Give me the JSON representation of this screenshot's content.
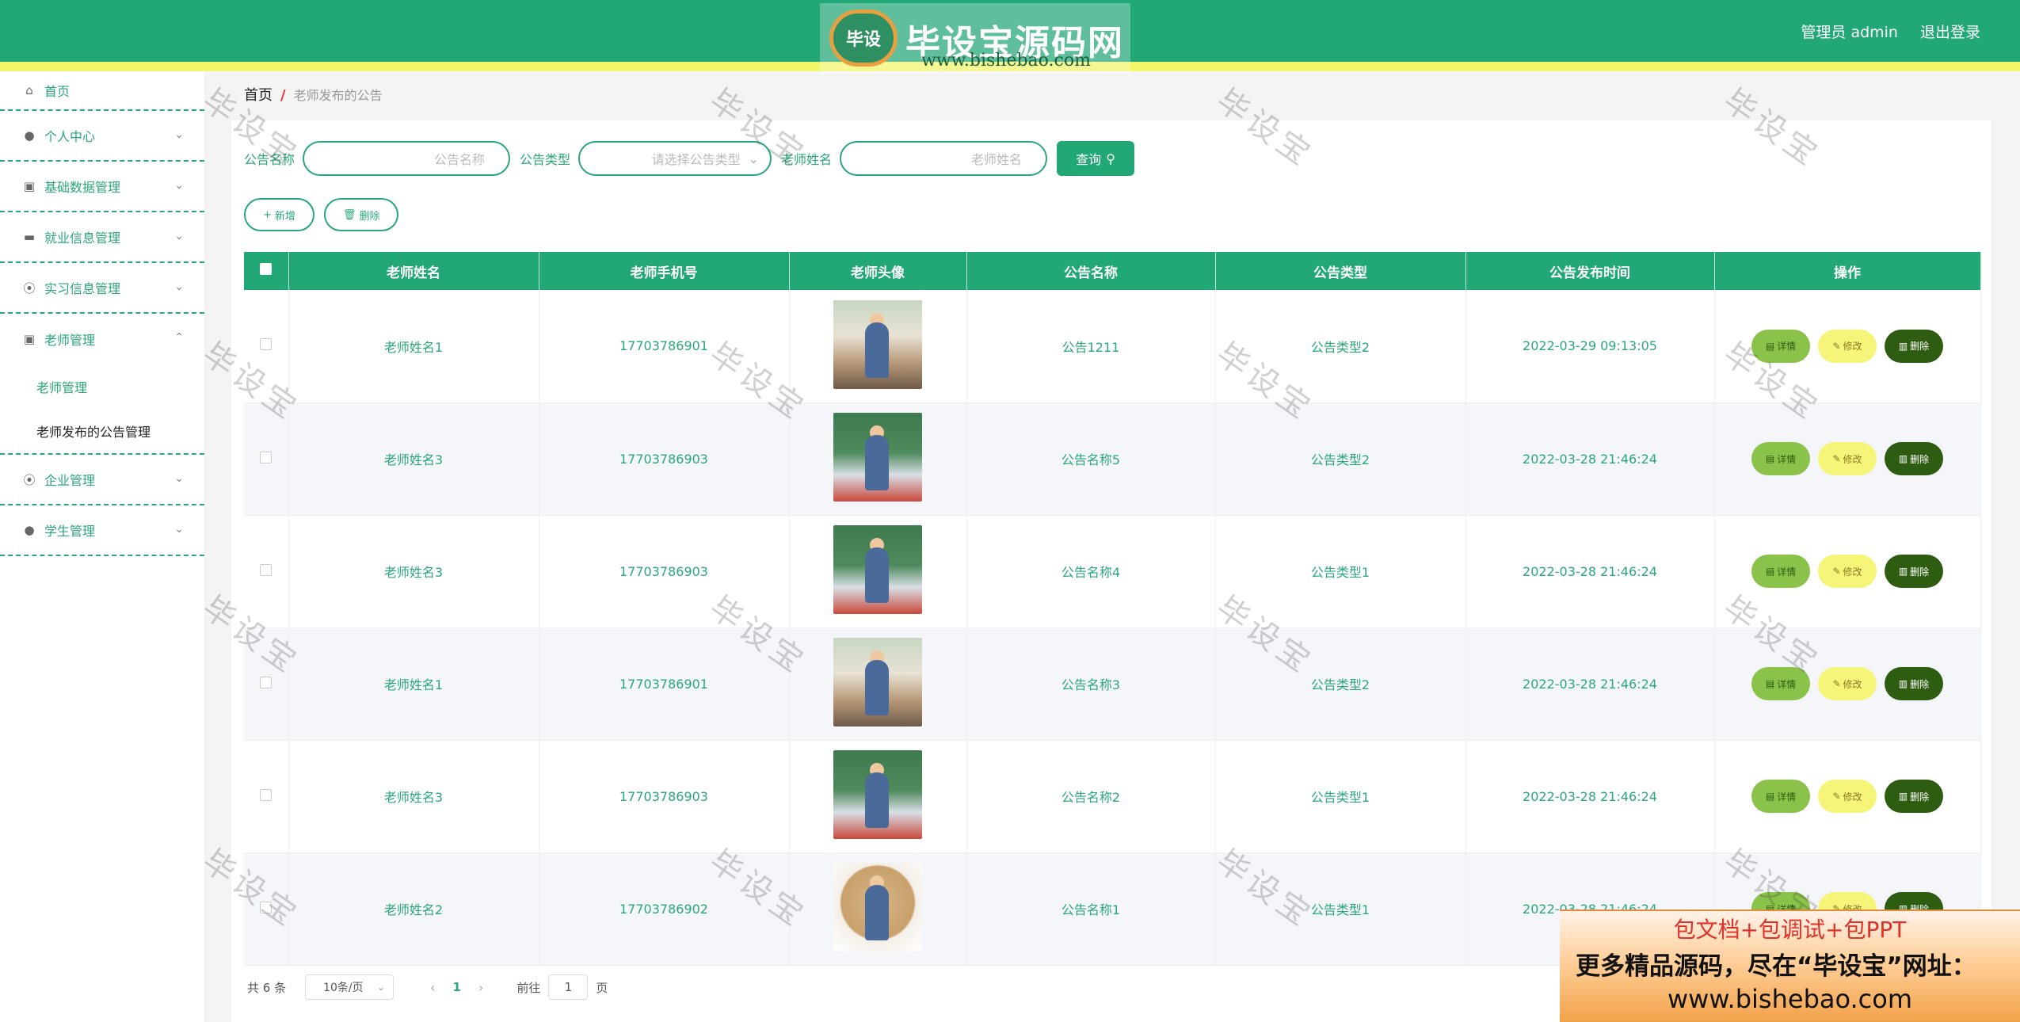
{
  "header": {
    "brand_badge": "毕设",
    "brand_title": "毕设宝源码网",
    "brand_url": "www.bishebao.com",
    "user": "管理员 admin",
    "logout": "退出登录"
  },
  "sidebar": {
    "home": "首页",
    "items": [
      {
        "label": "个人中心",
        "icon": "user-icon"
      },
      {
        "label": "基础数据管理",
        "icon": "clipboard-icon"
      },
      {
        "label": "就业信息管理",
        "icon": "monitor-icon"
      },
      {
        "label": "实习信息管理",
        "icon": "mic-icon"
      },
      {
        "label": "老师管理",
        "icon": "clipboard-check-icon"
      },
      {
        "label": "企业管理",
        "icon": "mic-icon"
      },
      {
        "label": "学生管理",
        "icon": "user-icon"
      }
    ],
    "teacher_sub": [
      "老师管理",
      "老师发布的公告管理"
    ]
  },
  "breadcrumb": {
    "home": "首页",
    "separator": "/",
    "current": "老师发布的公告"
  },
  "search": {
    "name_label": "公告名称",
    "name_placeholder": "公告名称",
    "type_label": "公告类型",
    "type_placeholder": "请选择公告类型",
    "teacher_label": "老师姓名",
    "teacher_placeholder": "老师姓名",
    "query_button": "查询"
  },
  "actions": {
    "add": "新增",
    "delete": "删除"
  },
  "table": {
    "headers": [
      "老师姓名",
      "老师手机号",
      "老师头像",
      "公告名称",
      "公告类型",
      "公告发布时间",
      "操作"
    ],
    "rows": [
      {
        "teacher": "老师姓名1",
        "phone": "17703786901",
        "title": "公告1211",
        "type": "公告类型2",
        "time": "2022-03-29 09:13:05"
      },
      {
        "teacher": "老师姓名3",
        "phone": "17703786903",
        "title": "公告名称5",
        "type": "公告类型2",
        "time": "2022-03-28 21:46:24"
      },
      {
        "teacher": "老师姓名3",
        "phone": "17703786903",
        "title": "公告名称4",
        "type": "公告类型1",
        "time": "2022-03-28 21:46:24"
      },
      {
        "teacher": "老师姓名1",
        "phone": "17703786901",
        "title": "公告名称3",
        "type": "公告类型2",
        "time": "2022-03-28 21:46:24"
      },
      {
        "teacher": "老师姓名3",
        "phone": "17703786903",
        "title": "公告名称2",
        "type": "公告类型1",
        "time": "2022-03-28 21:46:24"
      },
      {
        "teacher": "老师姓名2",
        "phone": "17703786902",
        "title": "公告名称1",
        "type": "公告类型1",
        "time": "2022-03-28 21:46:24"
      }
    ],
    "op_detail": "详情",
    "op_edit": "修改",
    "op_delete": "删除"
  },
  "pagination": {
    "total": "共 6 条",
    "page_size": "10条/页",
    "current_page": "1",
    "goto_prefix": "前往",
    "goto_value": "1",
    "goto_suffix": "页"
  },
  "watermark": "毕设宝",
  "promo": {
    "line1": "包文档+包调试+包PPT",
    "line2": "更多精品源码，尽在“毕设宝”网址：",
    "line3": "www.bishebao.com"
  },
  "colors": {
    "primary": "#22a777",
    "accent_strip": "#f3f76a",
    "detail": "#8bc34a",
    "edit": "#f5f57a",
    "delete": "#2e5d12"
  }
}
